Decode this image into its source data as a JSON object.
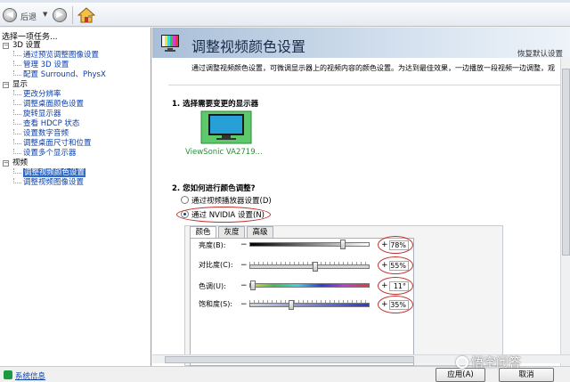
{
  "toolbar": {
    "back_label": "后退"
  },
  "left": {
    "title": "选择一项任务...",
    "categories": [
      {
        "label": "3D 设置",
        "items": [
          "通过预览调整图像设置",
          "管理 3D 设置",
          "配置 Surround、PhysX"
        ]
      },
      {
        "label": "显示",
        "items": [
          "更改分辨率",
          "调整桌面颜色设置",
          "旋转显示器",
          "查看 HDCP 状态",
          "设置数字音频",
          "调整桌面尺寸和位置",
          "设置多个显示器"
        ]
      },
      {
        "label": "视频",
        "items": [
          "调整视频颜色设置",
          "调整视频图像设置"
        ]
      }
    ]
  },
  "right": {
    "title": "调整视频颜色设置",
    "restore": "恢复默认设置",
    "description": "通过调整视频颜色设置，可微调显示器上的视频内容的颜色设置。为达到最佳效果，一边播放一段视频一边调整，观",
    "section1": "1. 选择需要变更的显示器",
    "monitor_label": "ViewSonic VA2719...",
    "section2": "2. 您如何进行颜色调整?",
    "radio1": "通过视频播放器设置(D)",
    "radio2": "通过 NVIDIA 设置(N)",
    "tabs": [
      "颜色",
      "灰度",
      "高级"
    ],
    "sliders": [
      {
        "label": "亮度(B):",
        "value": "78%",
        "level": 0.78
      },
      {
        "label": "对比度(C):",
        "value": "55%",
        "level": 0.55
      },
      {
        "label": "色调(U):",
        "value": "11°",
        "level": 0.03
      },
      {
        "label": "饱和度(S):",
        "value": "35%",
        "level": 0.35
      }
    ]
  },
  "footer": {
    "sysinfo": "系统信息",
    "apply": "应用(A)",
    "cancel": "取消"
  },
  "watermark": "悟空问答"
}
